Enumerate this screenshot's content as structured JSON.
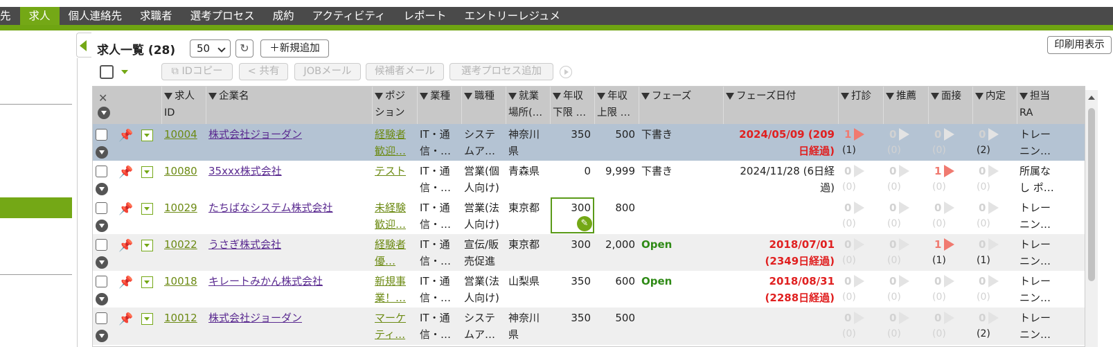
{
  "nav": {
    "items": [
      "先",
      "求人",
      "個人連絡先",
      "求職者",
      "選考プロセス",
      "成約",
      "アクティビティ",
      "レポート",
      "エントリーレジュメ"
    ],
    "active_index": 1
  },
  "toolbar": {
    "title": "求人一覧 (28)",
    "page_size": "50",
    "refresh_icon": "↻",
    "new_button": "＋新規追加",
    "print_button": "印刷用表示"
  },
  "actions": {
    "id_copy": "IDコピー",
    "share": "共有",
    "job_mail": "JOBメール",
    "candidate_mail": "候補者メール",
    "add_process": "選考プロセス追加"
  },
  "headers": {
    "id": [
      "求人",
      "ID"
    ],
    "company": [
      "企業名",
      ""
    ],
    "position": [
      "ポジ",
      "ション"
    ],
    "industry": [
      "業種",
      ""
    ],
    "job_type": [
      "職種",
      ""
    ],
    "location": [
      "就業",
      "場所(…"
    ],
    "salary_min": [
      "年収",
      "下限 …"
    ],
    "salary_max": [
      "年収",
      "上限 …"
    ],
    "phase": [
      "フェーズ",
      ""
    ],
    "phase_date": [
      "フェーズ日付",
      ""
    ],
    "contact": [
      "打診",
      ""
    ],
    "recommend": [
      "推薦",
      ""
    ],
    "interview": [
      "面接",
      ""
    ],
    "offer": [
      "内定",
      ""
    ],
    "ra": [
      "担当",
      "RA"
    ]
  },
  "rows": [
    {
      "id": "10004",
      "company": "株式会社ジョーダン",
      "pos1": "経験者",
      "pos2": "歓迎…",
      "ind1": "IT・通",
      "ind2": "信・…",
      "job1": "システ",
      "job2": "ムア…",
      "loc1": "神奈川",
      "loc2": "県",
      "min": "350",
      "max": "500",
      "phase": "下書き",
      "phase_class": "",
      "date1": "2024/05/09 (209",
      "date2": "日経過)",
      "date_class": "red",
      "c": {
        "top": "1",
        "sub": "(1)",
        "state": "hot"
      },
      "r": {
        "top": "0",
        "sub": "(0)",
        "state": "dim"
      },
      "i": {
        "top": "0",
        "sub": "(0)",
        "state": "dim"
      },
      "o": {
        "top": "0",
        "sub": "(2)",
        "state": "mute"
      },
      "ra1": "トレー",
      "ra2": "ニン…"
    },
    {
      "id": "10080",
      "company": "35xxx株式会社",
      "pos1": "テスト",
      "pos2": "",
      "ind1": "IT・通",
      "ind2": "信・…",
      "job1": "営業(個",
      "job2": "人向け)",
      "loc1": "青森県",
      "loc2": "",
      "min": "0",
      "max": "9,999",
      "phase": "下書き",
      "phase_class": "",
      "date1": "2024/11/28 (6日経",
      "date2": "過)",
      "date_class": "",
      "c": {
        "top": "0",
        "sub": "(0)",
        "state": "dim"
      },
      "r": {
        "top": "0",
        "sub": "(0)",
        "state": "dim"
      },
      "i": {
        "top": "1",
        "sub": "(0)",
        "state": "hot-dimsub"
      },
      "o": {
        "top": "0",
        "sub": "(0)",
        "state": "dim"
      },
      "ra1": "所属な",
      "ra2": "し ポ…"
    },
    {
      "id": "10029",
      "company": "たちばなシステム株式会社",
      "pos1": "未経験",
      "pos2": "歓迎…",
      "ind1": "IT・通",
      "ind2": "信・…",
      "job1": "営業(法",
      "job2": "人向け)",
      "loc1": "東京都",
      "loc2": "",
      "min": "300",
      "max": "800",
      "phase": "",
      "phase_class": "",
      "date1": "",
      "date2": "",
      "date_class": "",
      "c": {
        "top": "0",
        "sub": "(0)",
        "state": "dim"
      },
      "r": {
        "top": "0",
        "sub": "(0)",
        "state": "dim"
      },
      "i": {
        "top": "0",
        "sub": "(0)",
        "state": "dim"
      },
      "o": {
        "top": "0",
        "sub": "(0)",
        "state": "dim"
      },
      "ra1": "トレー",
      "ra2": "ニン…"
    },
    {
      "id": "10022",
      "company": "うさぎ株式会社",
      "pos1": "経験者",
      "pos2": "優…",
      "ind1": "IT・通",
      "ind2": "信・…",
      "job1": "宣伝/販",
      "job2": "売促進",
      "loc1": "東京都",
      "loc2": "",
      "min": "300",
      "max": "2,000",
      "phase": "Open",
      "phase_class": "green",
      "date1": "2018/07/01",
      "date2": "(2349日経過)",
      "date_class": "red",
      "c": {
        "top": "0",
        "sub": "(0)",
        "state": "dim"
      },
      "r": {
        "top": "0",
        "sub": "(0)",
        "state": "dim"
      },
      "i": {
        "top": "1",
        "sub": "(1)",
        "state": "hot"
      },
      "o": {
        "top": "0",
        "sub": "(1)",
        "state": "mute"
      },
      "ra1": "トレー",
      "ra2": "ニン…"
    },
    {
      "id": "10018",
      "company": "キレートみかん株式会社",
      "pos1": "新規事",
      "pos2": "業！…",
      "ind1": "IT・通",
      "ind2": "信・…",
      "job1": "営業(法",
      "job2": "人向け)",
      "loc1": "山梨県",
      "loc2": "",
      "min": "350",
      "max": "600",
      "phase": "Open",
      "phase_class": "green",
      "date1": "2018/08/31",
      "date2": "(2288日経過)",
      "date_class": "red",
      "c": {
        "top": "0",
        "sub": "(0)",
        "state": "dim"
      },
      "r": {
        "top": "0",
        "sub": "(0)",
        "state": "dim"
      },
      "i": {
        "top": "0",
        "sub": "(0)",
        "state": "dim"
      },
      "o": {
        "top": "0",
        "sub": "(0)",
        "state": "dim"
      },
      "ra1": "トレー",
      "ra2": "ニン…"
    },
    {
      "id": "10012",
      "company": "株式会社ジョーダン",
      "pos1": "マーケ",
      "pos2": "ティ…",
      "ind1": "IT・通",
      "ind2": "信・…",
      "job1": "システ",
      "job2": "ムア…",
      "loc1": "神奈川",
      "loc2": "県",
      "min": "350",
      "max": "500",
      "phase": "",
      "phase_class": "",
      "date1": "",
      "date2": "",
      "date_class": "",
      "c": {
        "top": "0",
        "sub": "(0)",
        "state": "dim"
      },
      "r": {
        "top": "0",
        "sub": "(0)",
        "state": "dim"
      },
      "i": {
        "top": "0",
        "sub": "(0)",
        "state": "dim"
      },
      "o": {
        "top": "0",
        "sub": "(2)",
        "state": "mute"
      },
      "ra1": "トレー",
      "ra2": "ニン…"
    }
  ],
  "colors": {
    "accent": "#74a816",
    "nav_bg": "#4a4a4a",
    "selected_row": "#b4c3d3",
    "alt_row": "#efefef"
  }
}
